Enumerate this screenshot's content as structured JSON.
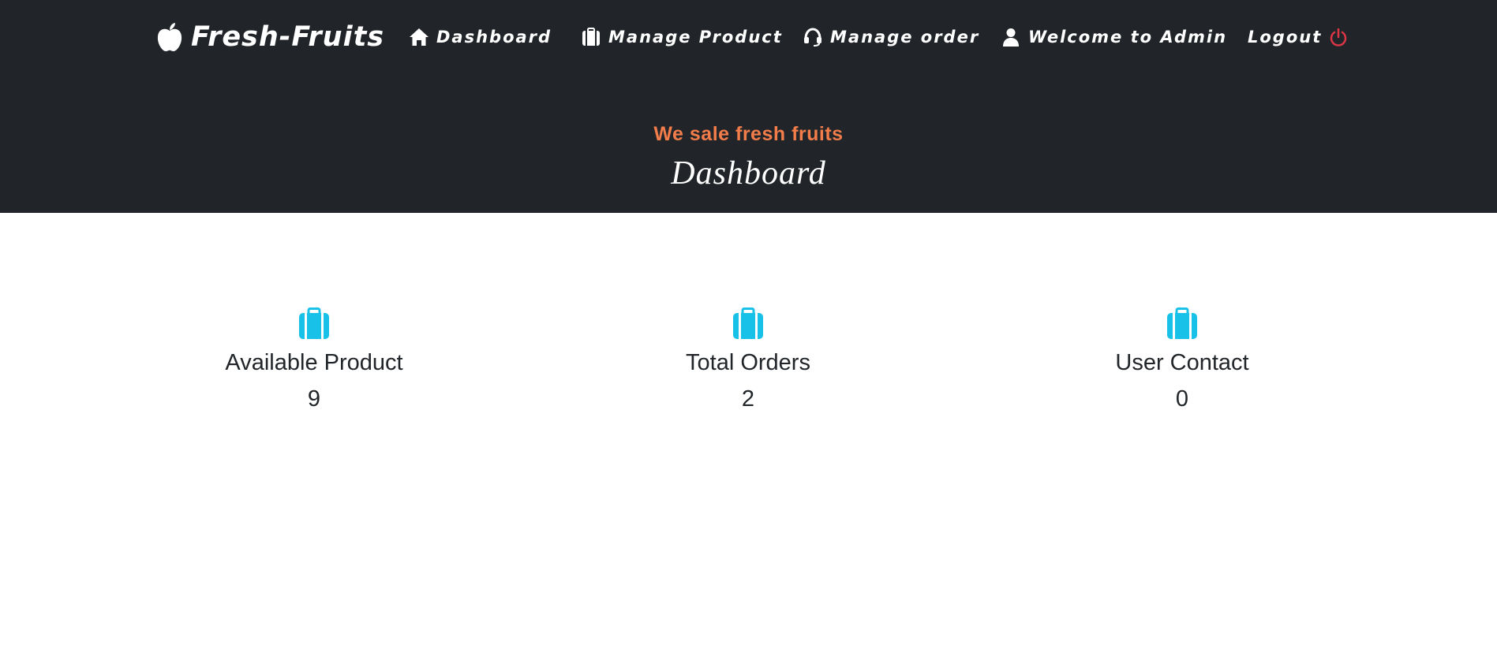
{
  "brand": {
    "name": "Fresh-Fruits",
    "icon": "apple-icon"
  },
  "nav": {
    "items": [
      {
        "label": "Dashboard",
        "icon": "home-icon"
      },
      {
        "label": "Manage Product",
        "icon": "briefcase-icon"
      },
      {
        "label": "Manage order",
        "icon": "headset-icon"
      },
      {
        "label": "Welcome to Admin",
        "icon": "user-icon"
      },
      {
        "label": "Logout",
        "icon": "power-icon"
      }
    ]
  },
  "hero": {
    "subtitle": "We sale fresh fruits",
    "title": "Dashboard"
  },
  "stats": [
    {
      "label": "Available Product",
      "value": "9",
      "icon": "briefcase-icon"
    },
    {
      "label": "Total Orders",
      "value": "2",
      "icon": "briefcase-icon"
    },
    {
      "label": "User Contact",
      "value": "0",
      "icon": "briefcase-icon"
    }
  ],
  "colors": {
    "header_bg": "#212529",
    "accent_orange": "#f27c4a",
    "icon_cyan": "#17c1e8",
    "logout_red": "#dc3545",
    "text_dark": "#212529"
  }
}
